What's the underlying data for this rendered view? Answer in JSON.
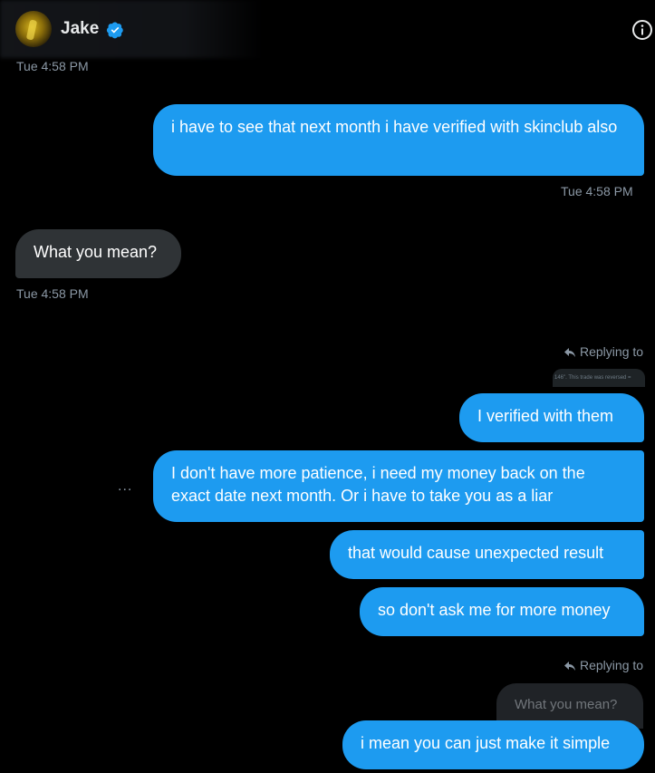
{
  "header": {
    "contact_name": "Jake",
    "verified_icon": "verified-badge-icon",
    "info_icon": "info-icon"
  },
  "messages": [
    {
      "type": "timestamp",
      "text": "Tue 4:58 PM"
    },
    {
      "type": "outgoing",
      "text": "i have to see that next month i have verified with skinclub also"
    },
    {
      "type": "timestamp",
      "text": "Tue 4:58 PM"
    },
    {
      "type": "incoming",
      "text": "What you mean?"
    },
    {
      "type": "timestamp",
      "text": "Tue 4:58 PM"
    },
    {
      "type": "reply_label",
      "text": "Replying to",
      "quoted_snippet": "146\". This trade was reversed ="
    },
    {
      "type": "outgoing",
      "text": "I verified with them"
    },
    {
      "type": "outgoing",
      "text": "I don't have more patience, i need my money back on the exact date next month. Or i have to take you as a liar"
    },
    {
      "type": "outgoing",
      "text": "that would cause unexpected result"
    },
    {
      "type": "outgoing",
      "text": "so don't ask me for more money"
    },
    {
      "type": "reply_label",
      "text": "Replying to",
      "quoted_text": "What you mean?"
    },
    {
      "type": "outgoing",
      "text": "i mean you can just make it simple"
    }
  ],
  "more_options": "...",
  "colors": {
    "accent": "#1d9bf0",
    "incoming_bubble": "#2f3336",
    "background": "#000000",
    "secondary_text": "#8b98a5"
  }
}
